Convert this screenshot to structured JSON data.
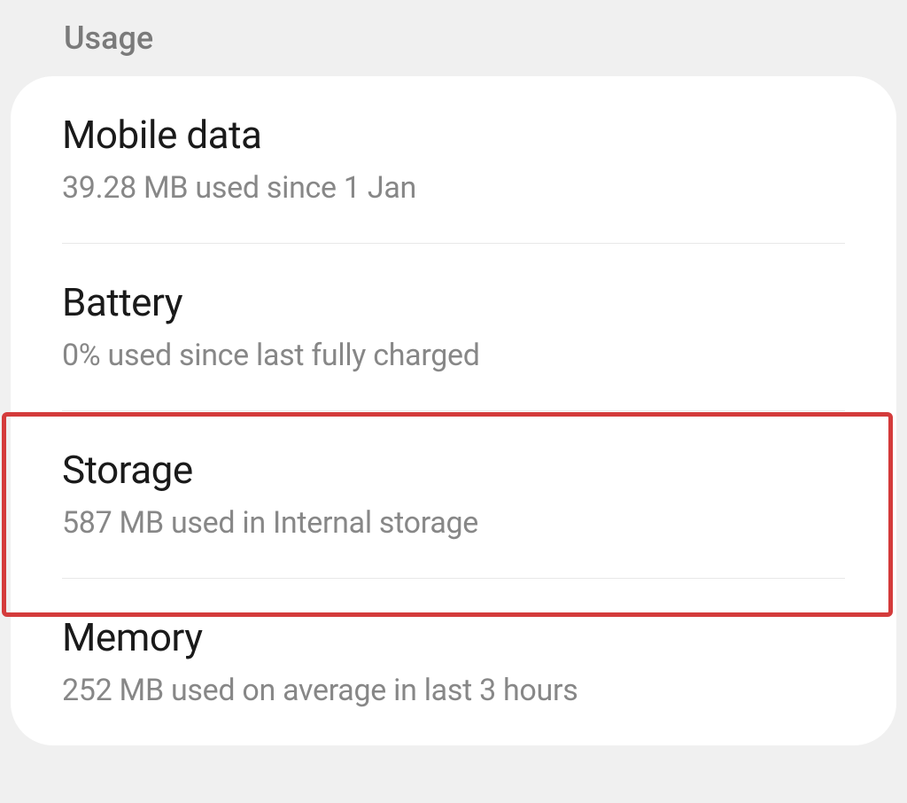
{
  "section": {
    "header": "Usage"
  },
  "items": [
    {
      "title": "Mobile data",
      "subtitle": "39.28 MB used since 1 Jan"
    },
    {
      "title": "Battery",
      "subtitle": "0% used since last fully charged"
    },
    {
      "title": "Storage",
      "subtitle": "587 MB used in Internal storage"
    },
    {
      "title": "Memory",
      "subtitle": "252 MB used on average in last 3 hours"
    }
  ]
}
